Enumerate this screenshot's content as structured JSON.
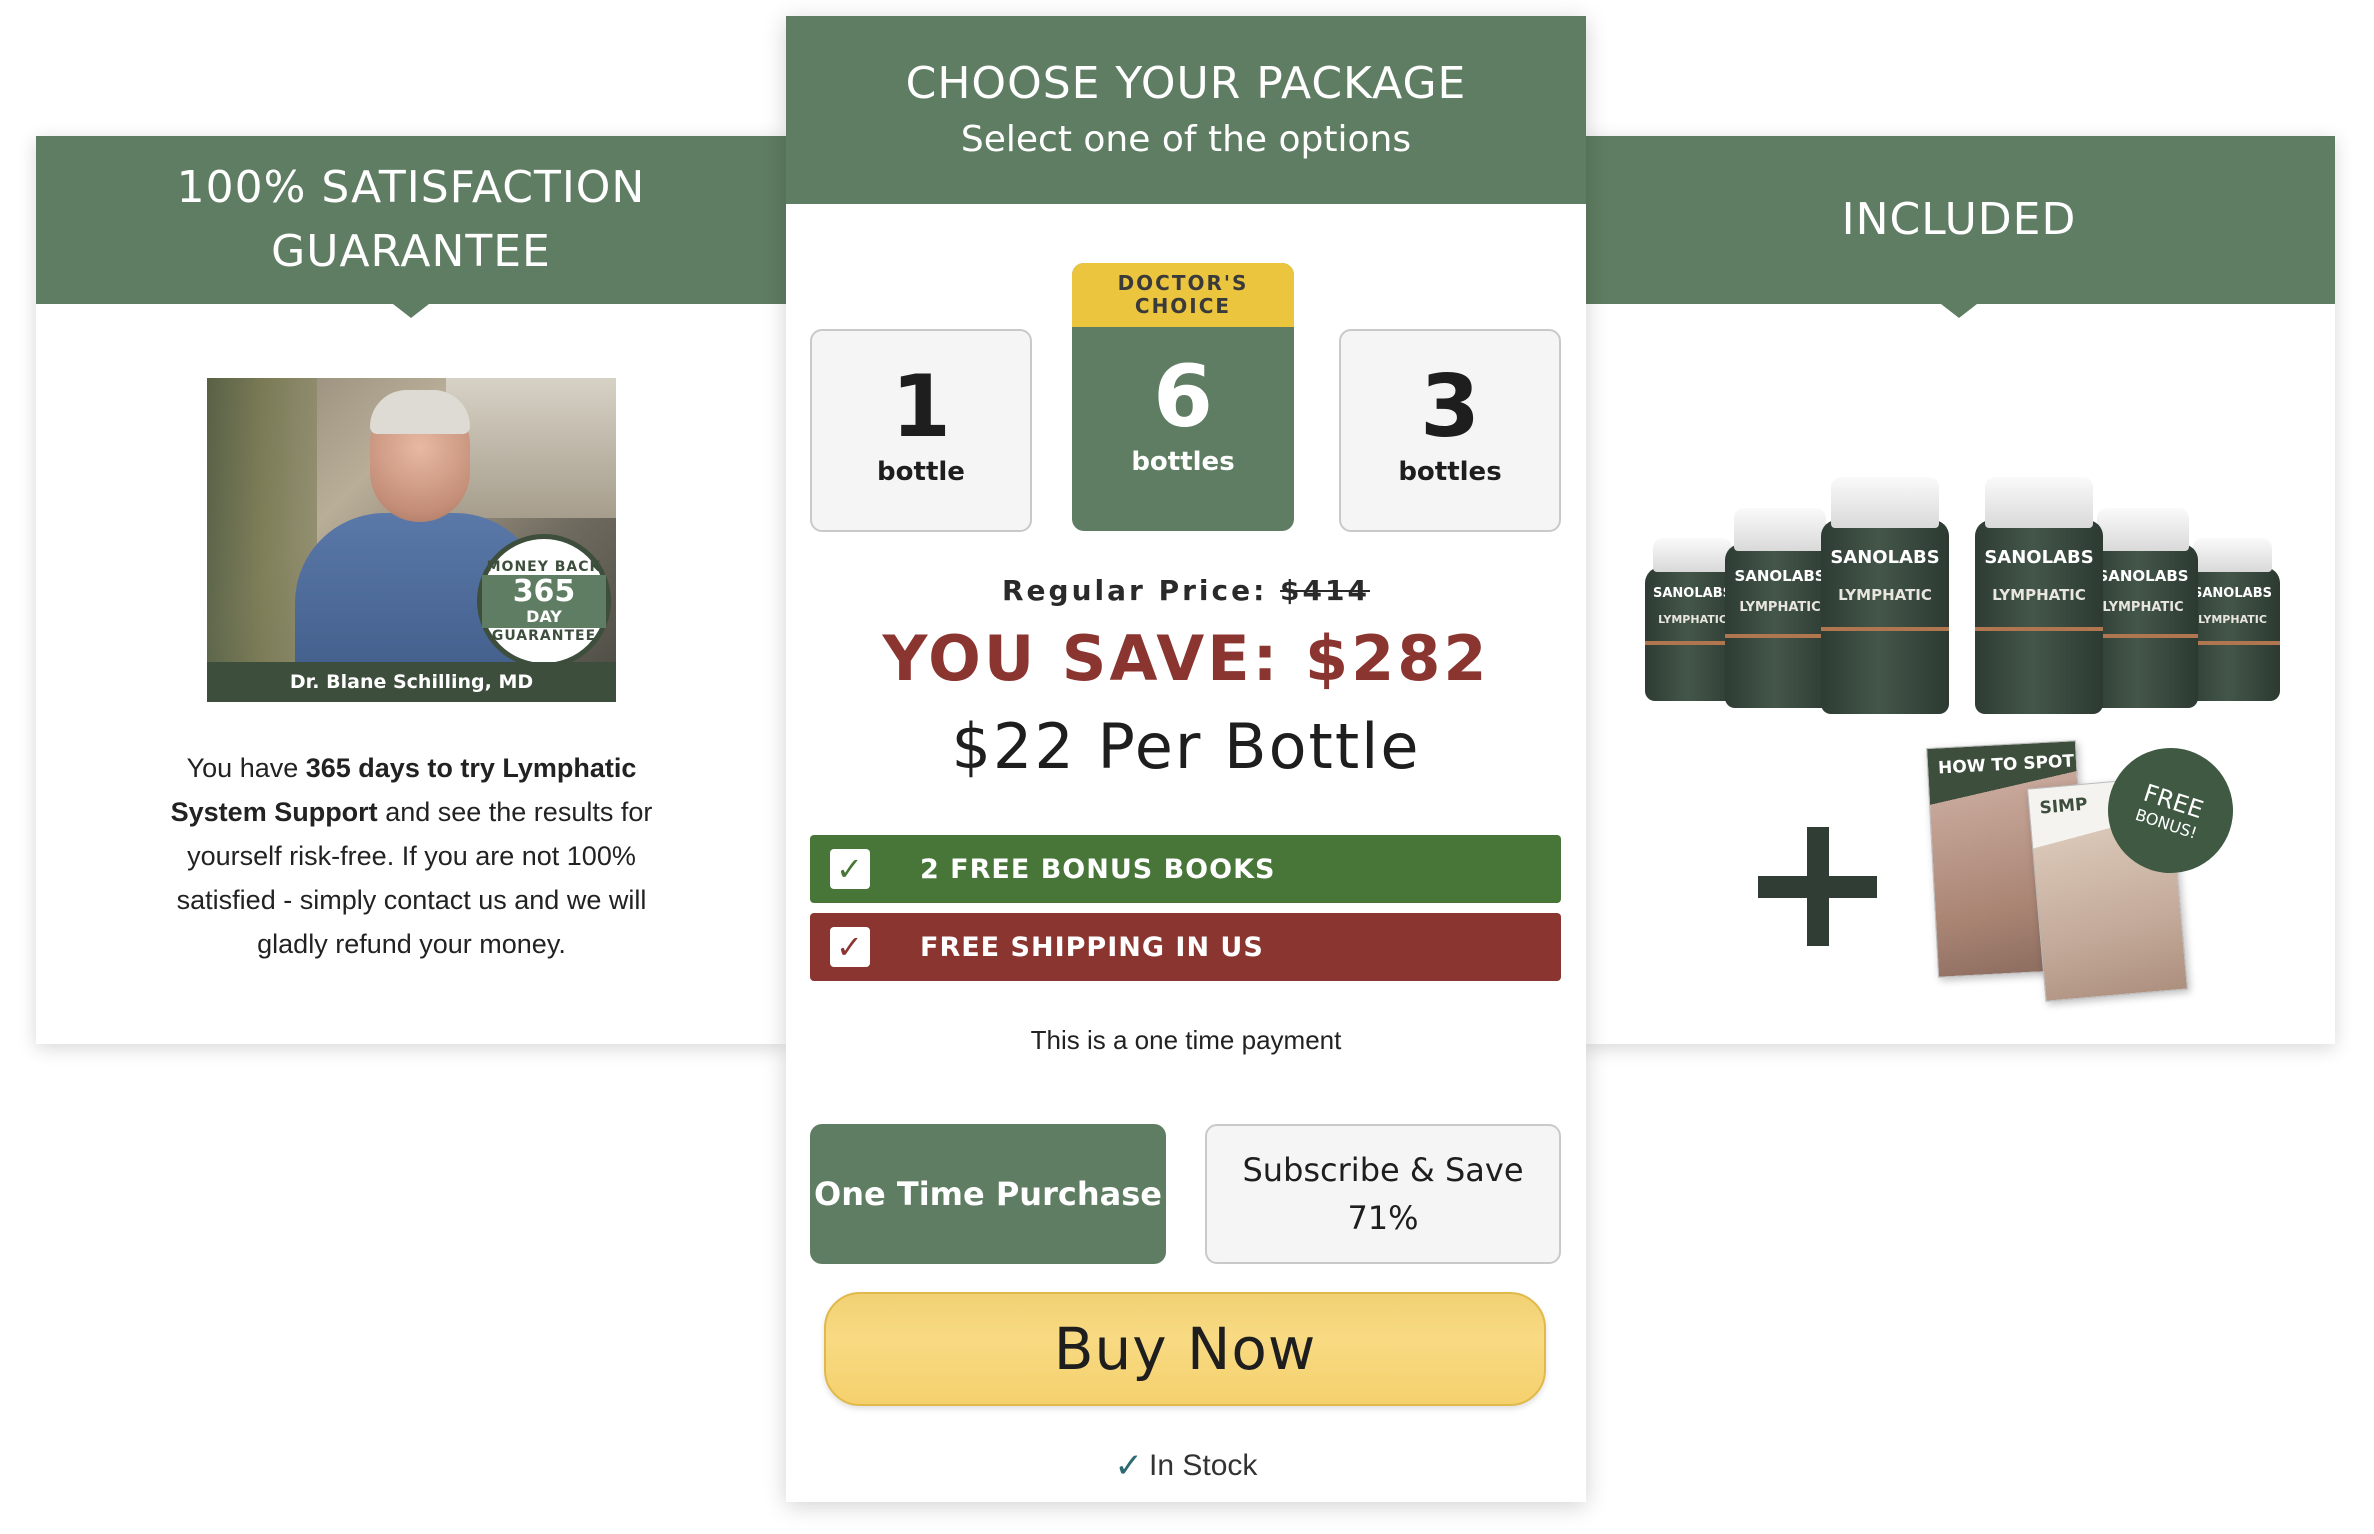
{
  "guarantee": {
    "title": "100% SATISFACTION\nGUARANTEE",
    "photo_caption": "Dr. Blane Schilling, MD",
    "seal": {
      "top": "MONEY BACK",
      "number": "365",
      "day": "DAY",
      "bottom": "GUARANTEE"
    },
    "text_1": "You have ",
    "text_bold_1": "365 days to try Lymphatic System Support",
    "text_2": " and see the results for yourself risk-free. If you are not 100% satisfied - simply contact us and we will gladly refund your money."
  },
  "package": {
    "title": "CHOOSE YOUR PACKAGE",
    "subtitle": "Select one of the options",
    "options": [
      {
        "count": "1",
        "unit": "bottle"
      },
      {
        "count": "6",
        "unit": "bottles",
        "ribbon": "DOCTOR'S\nCHOICE"
      },
      {
        "count": "3",
        "unit": "bottles"
      }
    ],
    "regular_label": "Regular Price: ",
    "regular_value": "$414",
    "you_save": "YOU SAVE: $282",
    "per_bottle": "$22 Per Bottle",
    "perks": [
      "2 FREE BONUS BOOKS",
      "FREE SHIPPING IN US"
    ],
    "payment_note": "This is a one time payment",
    "purchase_options": [
      "One Time Purchase",
      "Subscribe & Save",
      "71%"
    ],
    "buy_label": "Buy Now",
    "stock_label": "In Stock"
  },
  "included": {
    "title": "INCLUDED",
    "bottle_brand": "SANOLABS",
    "bottle_product": "LYMPHATIC",
    "book_title": "HOW TO SPOT",
    "book_b_title": "SIMP",
    "badge_1": "FREE",
    "badge_2": "BONUS!"
  },
  "colors": {
    "header_green": "#5f7d62",
    "ribbon_yellow": "#ecc53f",
    "save_red": "#8b3530",
    "perk_green": "#477638",
    "buy_gold": "#f5d16d"
  }
}
